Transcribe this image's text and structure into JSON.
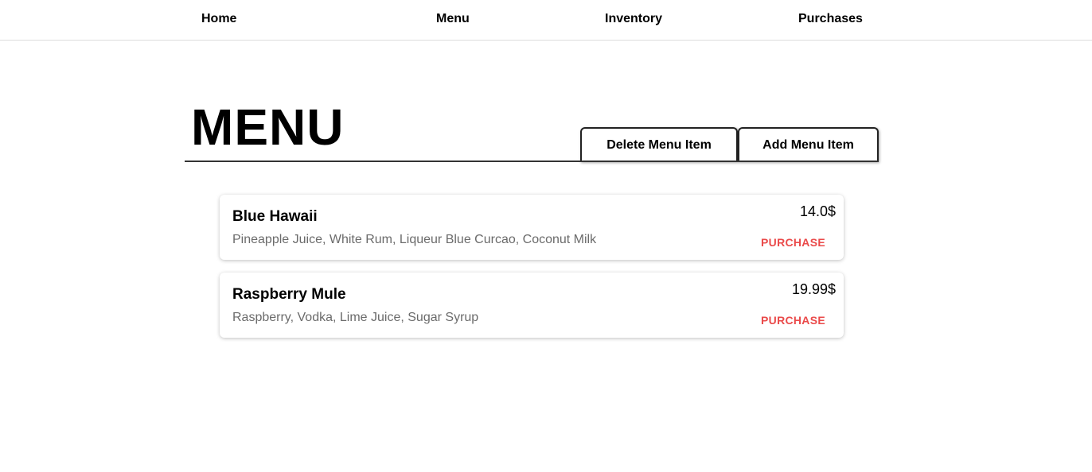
{
  "nav": {
    "home": "Home",
    "menu": "Menu",
    "inventory": "Inventory",
    "purchases": "Purchases"
  },
  "page": {
    "title": "MENU",
    "delete_label": "Delete Menu Item",
    "add_label": "Add Menu Item"
  },
  "items": [
    {
      "name": "Blue Hawaii",
      "ingredients": "Pineapple Juice, White Rum, Liqueur Blue Curcao, Coconut Milk",
      "price": "14.0$",
      "action": "PURCHASE"
    },
    {
      "name": "Raspberry Mule",
      "ingredients": "Raspberry, Vodka, Lime Juice, Sugar Syrup",
      "price": "19.99$",
      "action": "PURCHASE"
    }
  ],
  "colors": {
    "accent": "#ea4a4a",
    "description": "#6b6b6b",
    "rule": "#333333"
  }
}
